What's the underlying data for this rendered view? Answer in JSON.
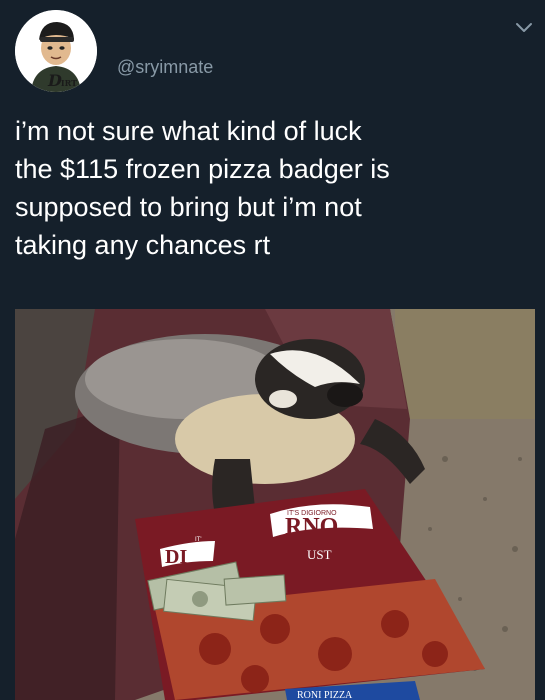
{
  "tweet": {
    "handle": "@sryimnate",
    "avatar_badge": "D",
    "avatar_badge_small": "IRT",
    "text": "i’m not sure what kind of luck\nthe $115 frozen pizza badger is\nsupposed to bring but i’m not\ntaking any chances rt"
  },
  "media": {
    "box_brand_small": "IT'S DIGIORNO",
    "box_brand_left": "DI",
    "box_brand_right": "RNO",
    "box_subtext": "UST",
    "box_bottom": "RONI PIZZA",
    "box_left_small": "IT'"
  },
  "colors": {
    "background": "#15202b",
    "text": "#ffffff",
    "secondary_text": "#8899a6"
  },
  "icons": {
    "menu": "chevron-down-icon"
  }
}
